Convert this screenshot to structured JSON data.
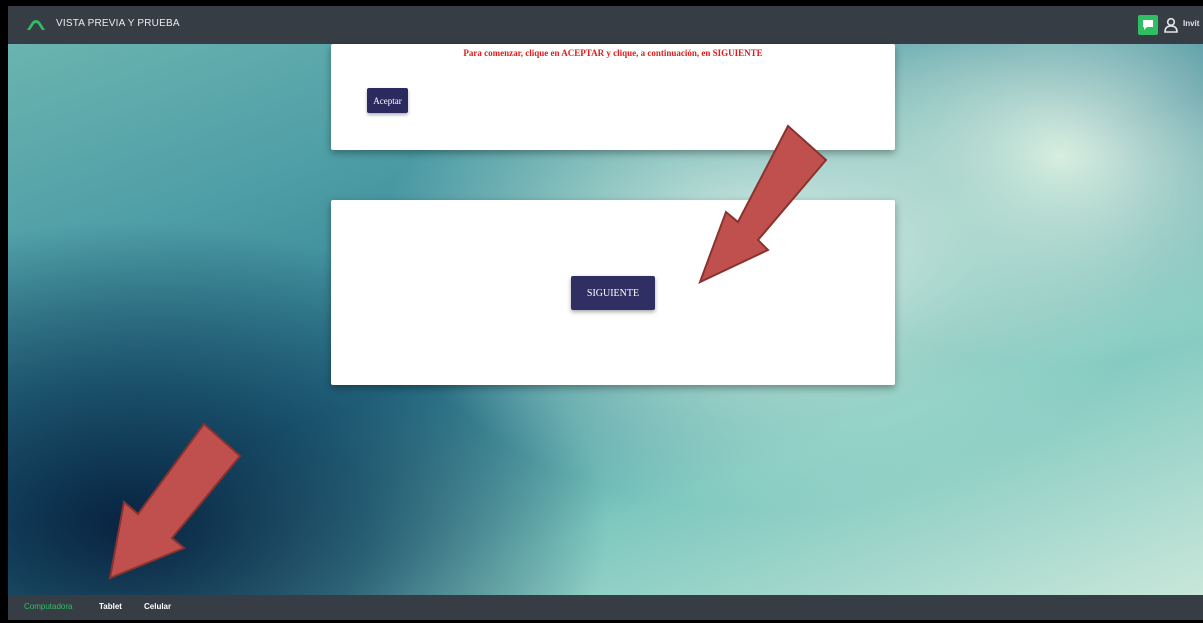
{
  "app": {
    "title": "VISTA PREVIA Y PRUEBA",
    "invite_label": "Invit"
  },
  "colors": {
    "topbar": "#373d45",
    "accent_green": "#2fbf62",
    "button_navy": "#2f2f63",
    "instruction_red": "#e21b1b",
    "arrow_red": "#c0504d"
  },
  "icons": {
    "logo": "arch-logo-icon",
    "chat": "chat-bubble-icon",
    "invite": "user-icon"
  },
  "content": {
    "instruction": "Para comenzar, clique en ACEPTAR  y clique, a continuación, en SIGUIENTE",
    "accept_label": "Aceptar",
    "next_label": "SIGUIENTE"
  },
  "devices": {
    "active": "Computadora",
    "items": [
      {
        "label": "Computadora"
      },
      {
        "label": "Tablet"
      },
      {
        "label": "Celular"
      }
    ]
  }
}
